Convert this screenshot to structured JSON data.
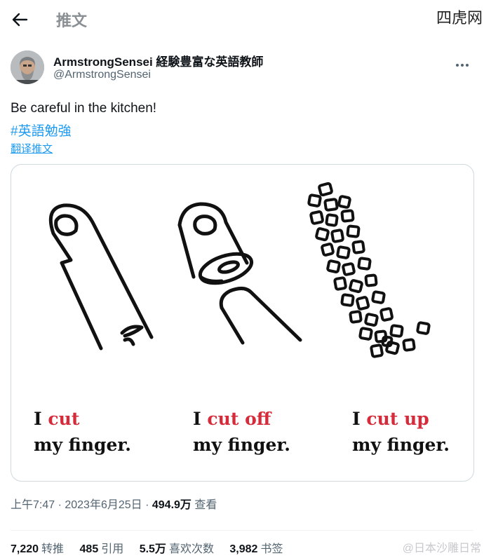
{
  "header": {
    "title": "推文",
    "back_icon": "arrow-left-icon",
    "watermark": "四虎网"
  },
  "author": {
    "name": "ArmstrongSensei 経験豊富な英語教師",
    "handle": "@ArmstrongSensei"
  },
  "tweet": {
    "text": "Be careful in the kitchen!",
    "hashtag": "#英語勉強",
    "translate_label": "翻译推文"
  },
  "image": {
    "captions": [
      {
        "red": "cut",
        "line2": "my finger."
      },
      {
        "red": "cut off",
        "line2": "my finger."
      },
      {
        "red": "cut up",
        "line2": "my finger."
      }
    ],
    "pronoun": "I"
  },
  "meta": {
    "time": "上午7:47 · 2023年6月25日 · ",
    "views": "494.9万",
    "views_label": "查看"
  },
  "stats": [
    {
      "value": "7,220",
      "label": "转推"
    },
    {
      "value": "485",
      "label": "引用"
    },
    {
      "value": "5.5万",
      "label": "喜欢次数"
    },
    {
      "value": "3,982",
      "label": "书签"
    }
  ],
  "watermark_bottom": "@日本沙雕日常",
  "colors": {
    "link": "#1d9bf0",
    "caption_red": "#d62b3a",
    "muted": "#536471"
  }
}
